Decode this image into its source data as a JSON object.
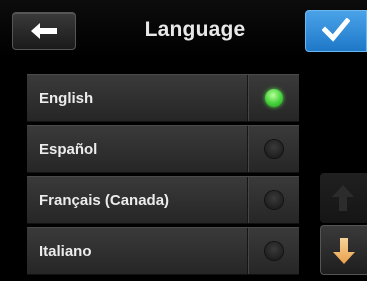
{
  "header": {
    "title": "Language",
    "back_icon": "left-arrow-icon",
    "confirm_icon": "checkmark-icon"
  },
  "languages": [
    {
      "label": "English",
      "selected": true
    },
    {
      "label": "Español",
      "selected": false
    },
    {
      "label": "Français (Canada)",
      "selected": false
    },
    {
      "label": "Italiano",
      "selected": false
    }
  ],
  "scroll": {
    "up_enabled": false,
    "down_enabled": true,
    "up_icon": "arrow-up-icon",
    "down_icon": "arrow-down-icon"
  },
  "colors": {
    "accent": "#2a8ad8",
    "selected_radio": "#43d13a",
    "scroll_down_arrow": "#f2b86a"
  }
}
